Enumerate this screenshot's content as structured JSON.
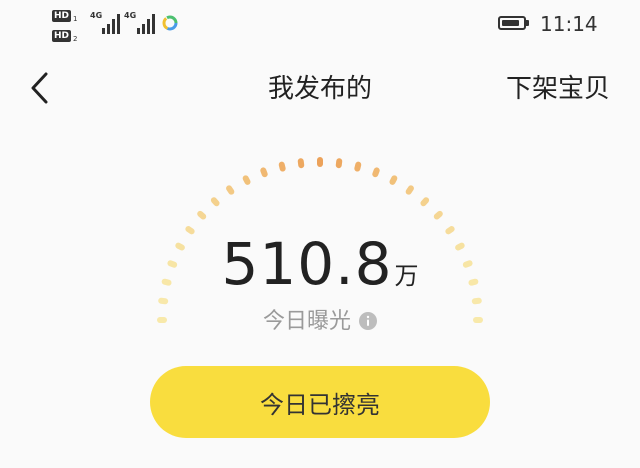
{
  "status_bar": {
    "sim1_label": "HD",
    "sim1_index": "1",
    "sim2_label": "HD",
    "sim2_index": "2",
    "network1": "4G",
    "network2": "4G",
    "time": "11:14",
    "battery_level": 0.7
  },
  "nav": {
    "back_icon": "chevron-left-icon",
    "title": "我发布的",
    "right_action": "下架宝贝"
  },
  "exposure": {
    "value": "510.8",
    "unit": "万",
    "caption": "今日曝光",
    "info_icon": "info-icon"
  },
  "action": {
    "label": "今日已擦亮"
  },
  "colors": {
    "background": "#fafafa",
    "button_yellow": "#f9dd3e",
    "gauge_orange": "#eca25a",
    "gauge_yellow": "#f7e28c",
    "caption_gray": "#9a9a9a"
  }
}
